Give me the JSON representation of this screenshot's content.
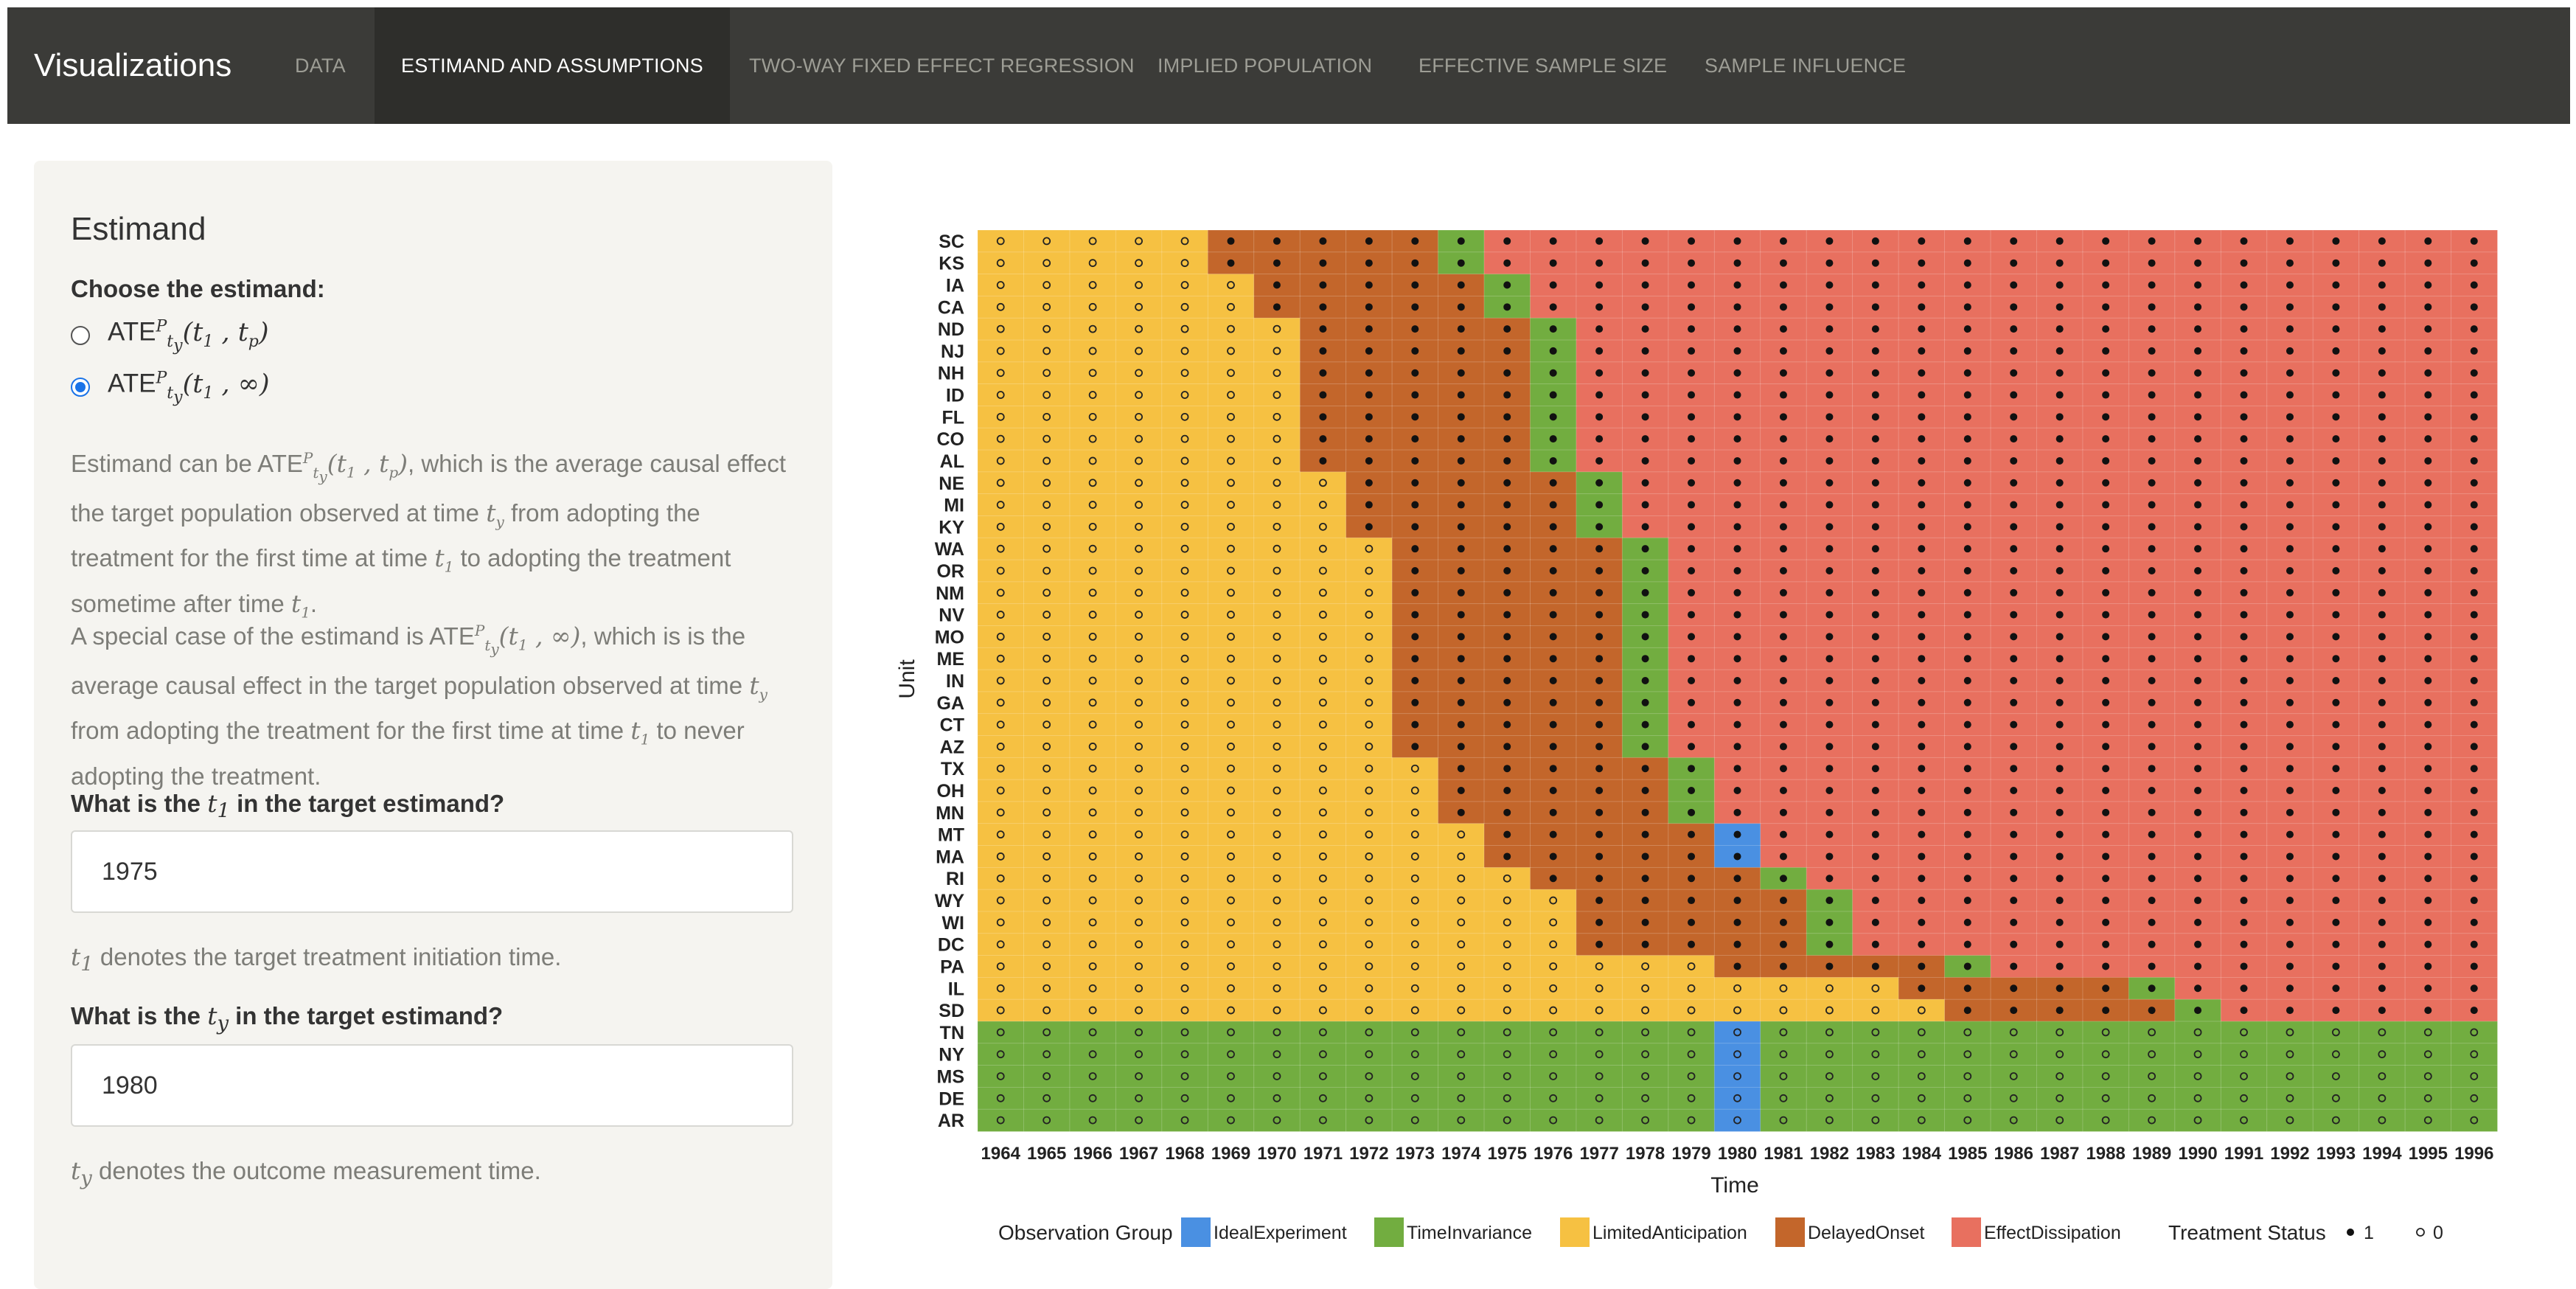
{
  "navbar": {
    "brand": "Visualizations",
    "tabs": [
      "DATA",
      "ESTIMAND AND ASSUMPTIONS",
      "TWO-WAY FIXED EFFECT REGRESSION",
      "IMPLIED POPULATION",
      "EFFECTIVE SAMPLE SIZE",
      "SAMPLE INFLUENCE"
    ],
    "active_tab": "ESTIMAND AND ASSUMPTIONS"
  },
  "sidebar": {
    "title": "Estimand",
    "choose_label": "Choose the estimand:",
    "options": [
      "ATE_{t_y}^P(t_1, t_p)",
      "ATE_{t_y}^P(t_1, ∞)"
    ],
    "selected_option": "ATE_{t_y}^P(t_1, ∞)",
    "description_1": "Estimand can be ATE_{t_y}^P(t_1, t_p), which is the average causal effect the target population observed at time t_y from adopting the treatment for the first time at time t_1 to adopting the treatment sometime after time t_1.",
    "description_2": "A special case of the estimand is ATE_{t_y}^P(t_1, ∞), which is is the average causal effect in the target population observed at time t_y from adopting the treatment for the first time at time t_1 to never adopting the treatment.",
    "t1_question": "What is the t_1 in the target estimand?",
    "t1_value": "1975",
    "t1_help": "t_1 denotes the target treatment initiation time.",
    "ty_question": "What is the t_y in the target estimand?",
    "ty_value": "1980",
    "ty_help": "t_y denotes the outcome measurement time."
  },
  "chart_data": {
    "type": "heatmap",
    "xlabel": "Time",
    "ylabel": "Unit",
    "years": [
      1964,
      1965,
      1966,
      1967,
      1968,
      1969,
      1970,
      1971,
      1972,
      1973,
      1974,
      1975,
      1976,
      1977,
      1978,
      1979,
      1980,
      1981,
      1982,
      1983,
      1984,
      1985,
      1986,
      1987,
      1988,
      1989,
      1990,
      1991,
      1992,
      1993,
      1994,
      1995,
      1996
    ],
    "units": [
      {
        "name": "SC",
        "adoption_year": 1969
      },
      {
        "name": "KS",
        "adoption_year": 1969
      },
      {
        "name": "IA",
        "adoption_year": 1970
      },
      {
        "name": "CA",
        "adoption_year": 1970
      },
      {
        "name": "ND",
        "adoption_year": 1971
      },
      {
        "name": "NJ",
        "adoption_year": 1971
      },
      {
        "name": "NH",
        "adoption_year": 1971
      },
      {
        "name": "ID",
        "adoption_year": 1971
      },
      {
        "name": "FL",
        "adoption_year": 1971
      },
      {
        "name": "CO",
        "adoption_year": 1971
      },
      {
        "name": "AL",
        "adoption_year": 1971
      },
      {
        "name": "NE",
        "adoption_year": 1972
      },
      {
        "name": "MI",
        "adoption_year": 1972
      },
      {
        "name": "KY",
        "adoption_year": 1972
      },
      {
        "name": "WA",
        "adoption_year": 1973
      },
      {
        "name": "OR",
        "adoption_year": 1973
      },
      {
        "name": "NM",
        "adoption_year": 1973
      },
      {
        "name": "NV",
        "adoption_year": 1973
      },
      {
        "name": "MO",
        "adoption_year": 1973
      },
      {
        "name": "ME",
        "adoption_year": 1973
      },
      {
        "name": "IN",
        "adoption_year": 1973
      },
      {
        "name": "GA",
        "adoption_year": 1973
      },
      {
        "name": "CT",
        "adoption_year": 1973
      },
      {
        "name": "AZ",
        "adoption_year": 1973
      },
      {
        "name": "TX",
        "adoption_year": 1974
      },
      {
        "name": "OH",
        "adoption_year": 1974
      },
      {
        "name": "MN",
        "adoption_year": 1974
      },
      {
        "name": "MT",
        "adoption_year": 1975
      },
      {
        "name": "MA",
        "adoption_year": 1975
      },
      {
        "name": "RI",
        "adoption_year": 1976
      },
      {
        "name": "WY",
        "adoption_year": 1977
      },
      {
        "name": "WI",
        "adoption_year": 1977
      },
      {
        "name": "DC",
        "adoption_year": 1977
      },
      {
        "name": "PA",
        "adoption_year": 1980
      },
      {
        "name": "IL",
        "adoption_year": 1984
      },
      {
        "name": "SD",
        "adoption_year": 1985
      },
      {
        "name": "TN",
        "adoption_year": null
      },
      {
        "name": "NY",
        "adoption_year": null
      },
      {
        "name": "MS",
        "adoption_year": null
      },
      {
        "name": "DE",
        "adoption_year": null
      },
      {
        "name": "AR",
        "adoption_year": null
      }
    ],
    "legend": {
      "group_title": "Observation Group",
      "groups": [
        {
          "name": "IdealExperiment",
          "color": "#4a90e2"
        },
        {
          "name": "TimeInvariance",
          "color": "#72ad40"
        },
        {
          "name": "LimitedAnticipation",
          "color": "#f6c142"
        },
        {
          "name": "DelayedOnset",
          "color": "#c3662b"
        },
        {
          "name": "EffectDissipation",
          "color": "#e8705f"
        }
      ],
      "status_title": "Treatment Status",
      "status": [
        {
          "label": "1",
          "marker": "filled-dot"
        },
        {
          "label": "0",
          "marker": "open-circle"
        }
      ],
      "placement": "bottom"
    }
  }
}
